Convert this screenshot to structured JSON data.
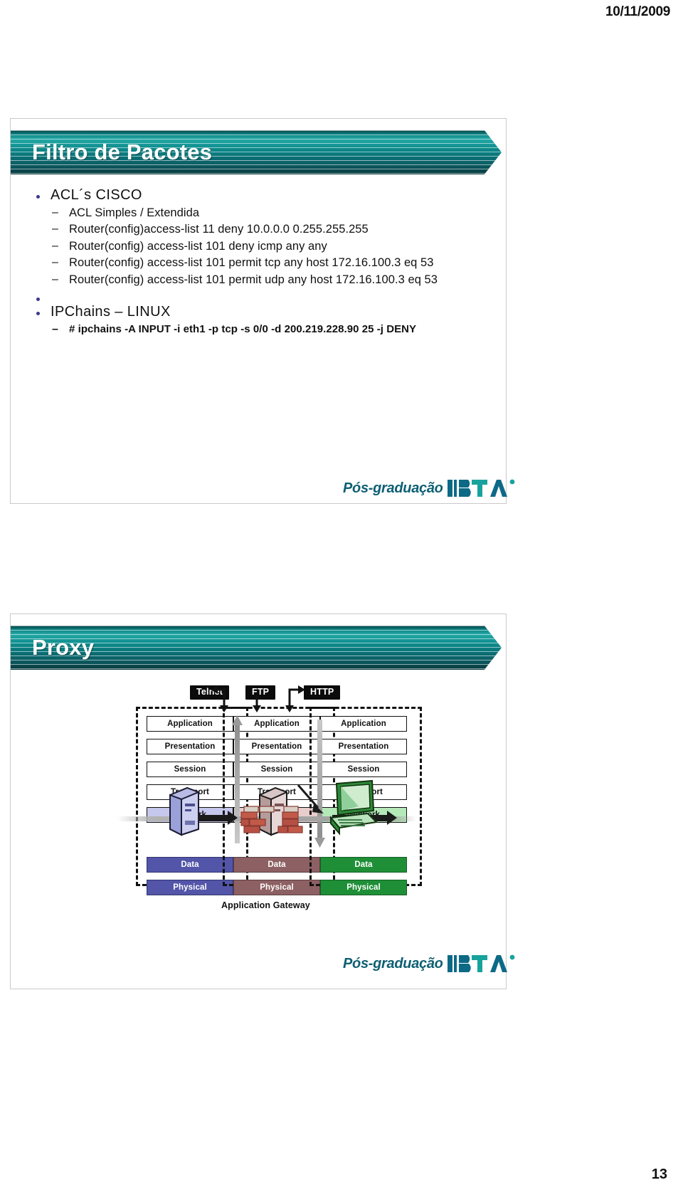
{
  "page": {
    "date": "10/11/2009",
    "number": "13"
  },
  "slides": [
    {
      "title": "Filtro de Pacotes",
      "bullets": [
        {
          "label": "ACL´s CISCO",
          "sub": [
            {
              "text": "ACL Simples /  Extendida",
              "bold": false
            },
            {
              "text": "Router(config)access-list 11 deny 10.0.0.0 0.255.255.255",
              "bold": false
            },
            {
              "text": "Router(config) access-list 101 deny icmp any any",
              "bold": false
            },
            {
              "text": "Router(config) access-list 101 permit tcp any host 172.16.100.3 eq 53",
              "bold": false
            },
            {
              "text": "Router(config) access-list 101 permit udp any host 172.16.100.3 eq 53",
              "bold": false
            }
          ]
        },
        {
          "label": "IPChains – LINUX",
          "sub": [
            {
              "text": "# ipchains -A INPUT -i eth1 -p tcp -s 0/0 -d 200.219.228.90 25 -j DENY",
              "bold": true
            }
          ]
        }
      ],
      "logo": {
        "text": "Pós-graduação",
        "mark": "IBTA"
      }
    },
    {
      "title": "Proxy",
      "logo": {
        "text": "Pós-graduação",
        "mark": "IBTA"
      }
    }
  ],
  "diagram": {
    "protocols": [
      "Telnet",
      "FTP",
      "HTTP"
    ],
    "columns": [
      {
        "name": "client-stack",
        "layers": [
          "Application",
          "Presentation",
          "Session",
          "Transport",
          "Network"
        ],
        "lower": [
          "Data",
          "Physical"
        ],
        "network_color": "#c6c7ec",
        "data_color": "#5255a8",
        "device": "client-tower"
      },
      {
        "name": "gateway-stack",
        "layers": [
          "Application",
          "Presentation",
          "Session",
          "Transport",
          "Network"
        ],
        "lower": [
          "Data",
          "Physical"
        ],
        "network_color": "#e8cdcd",
        "data_color": "#8d6063",
        "device": "firewall-tower"
      },
      {
        "name": "server-stack",
        "layers": [
          "Application",
          "Presentation",
          "Session",
          "Transport",
          "Network"
        ],
        "lower": [
          "Data",
          "Physical"
        ],
        "network_color": "#b5e8b9",
        "data_color": "#1f8f37",
        "device": "workstation"
      }
    ],
    "caption": "Application Gateway"
  },
  "colors": {
    "banner_teal": "#0d8a8b",
    "banner_dark": "#06383c",
    "bullet_navy": "#3a3a8c",
    "logo_teal": "#0e5f73"
  }
}
